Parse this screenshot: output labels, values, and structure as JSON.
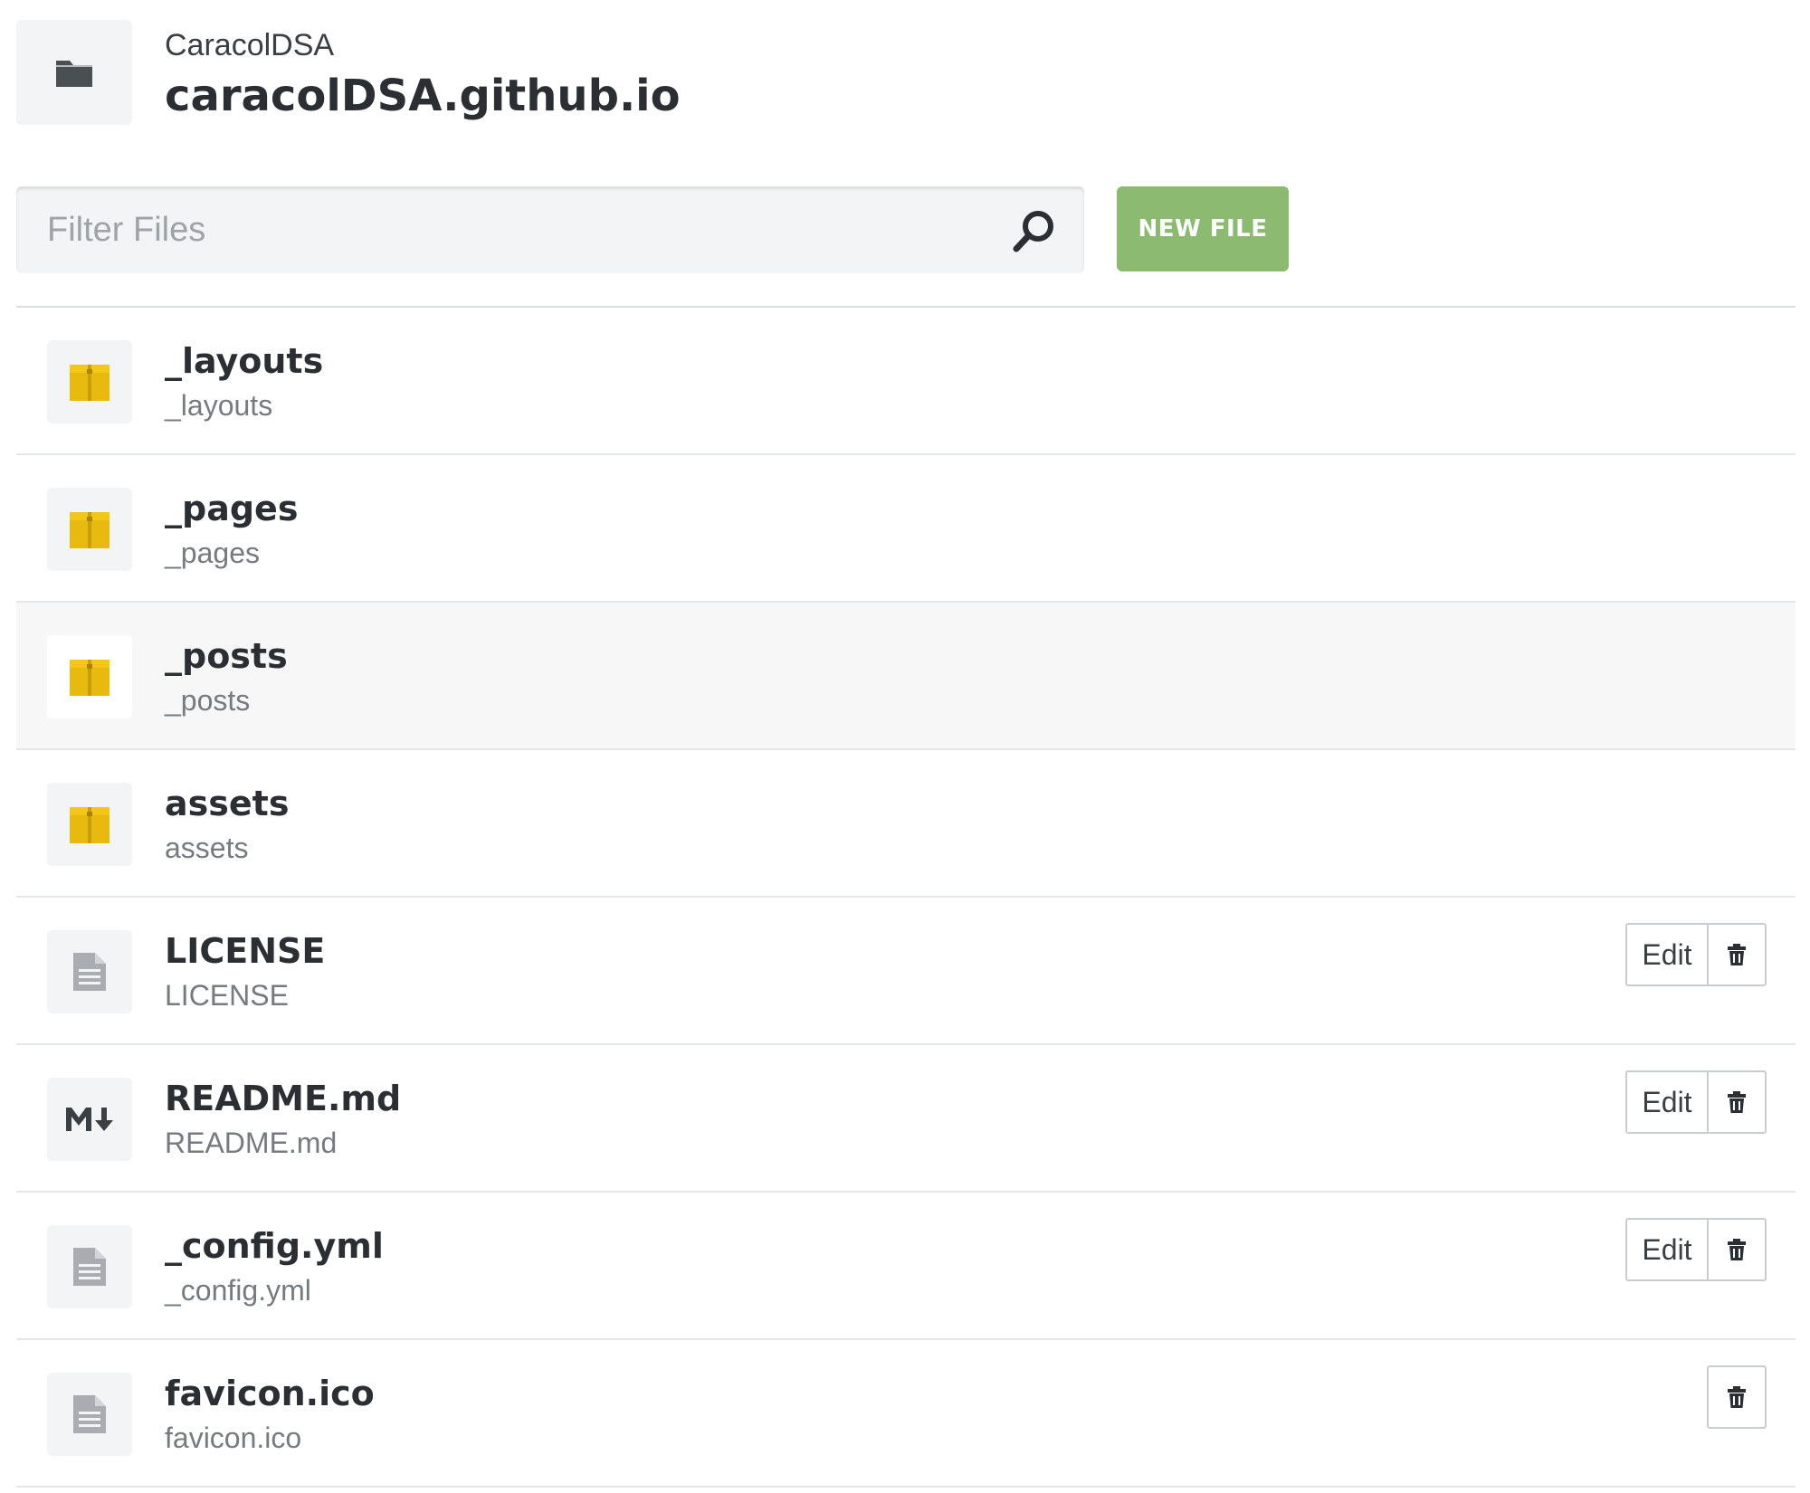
{
  "header": {
    "owner": "CaracolDSA",
    "repo_name": "caracolDSA.github.io",
    "icon": "folder-icon"
  },
  "filter": {
    "placeholder": "Filter Files",
    "value": "",
    "icon": "search-icon"
  },
  "toolbar": {
    "new_file_label": "NEW FILE"
  },
  "colors": {
    "new_file_button": "#8dba71",
    "folder_icon": "#e8b90e",
    "row_highlight": "#f7f7f7"
  },
  "files": [
    {
      "name": "_layouts",
      "path": "_layouts",
      "type": "folder",
      "icon": "folder-icon"
    },
    {
      "name": "_pages",
      "path": "_pages",
      "type": "folder",
      "icon": "folder-icon"
    },
    {
      "name": "_posts",
      "path": "_posts",
      "type": "folder",
      "icon": "folder-icon",
      "highlighted": true
    },
    {
      "name": "assets",
      "path": "assets",
      "type": "folder",
      "icon": "folder-icon"
    },
    {
      "name": "LICENSE",
      "path": "LICENSE",
      "type": "file",
      "icon": "document-icon",
      "edit_label": "Edit"
    },
    {
      "name": "README.md",
      "path": "README.md",
      "type": "file",
      "icon": "markdown-icon",
      "edit_label": "Edit"
    },
    {
      "name": "_config.yml",
      "path": "_config.yml",
      "type": "file",
      "icon": "document-icon",
      "edit_label": "Edit"
    },
    {
      "name": "favicon.ico",
      "path": "favicon.ico",
      "type": "file",
      "icon": "document-icon"
    }
  ]
}
